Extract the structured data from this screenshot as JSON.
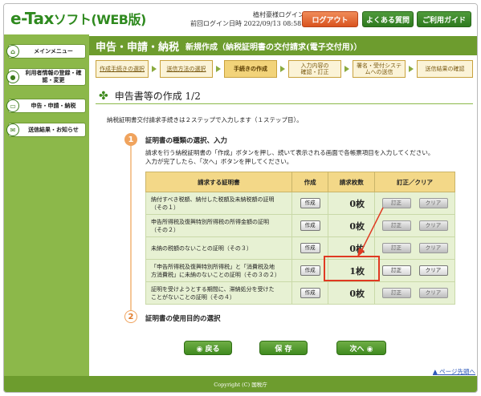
{
  "header": {
    "logo_main": "e-Tax",
    "logo_sub": "ソフト(WEB版)",
    "login_user": "植村豪様ログイン中",
    "last_login_label": "前回ログイン日時",
    "last_login_value": "2022/09/13 08:58",
    "logout_label": "ログアウト",
    "faq_label": "よくある質問",
    "guide_label": "ご利用ガイド"
  },
  "sidebar": {
    "items": [
      {
        "label": "メインメニュー",
        "icon": "house-icon"
      },
      {
        "label": "利用者情報の登録・確認・変更",
        "icon": "person-icon"
      },
      {
        "label": "申告・申請・納税",
        "icon": "document-icon"
      },
      {
        "label": "送信結果・お知らせ",
        "icon": "mail-icon"
      }
    ]
  },
  "main": {
    "title": "申告・申請・納税",
    "subtitle": "新規作成（納税証明書の交付請求(電子交付用)）",
    "steps": [
      "作成手続きの選択",
      "送信方法の選択",
      "手続きの作成",
      "入力内容の\n確認・訂正",
      "署名・受付システ\nムへの送信",
      "送信結果の確認"
    ],
    "section_title": "申告書等の作成 1/2",
    "intro": "納税証明書交付請求手続きは２ステップで入力します（１ステップ目）。",
    "step1_num": "1",
    "step1_title": "証明書の種類の選択、入力",
    "step1_desc_line1": "請求を行う納税証明書の「作成」ボタンを押し、続いて表示される画面で各帳票項目を入力してください。",
    "step1_desc_line2": "入力が完了したら、「次へ」ボタンを押してください。",
    "step2_num": "2",
    "step2_title": "証明書の使用目的の選択"
  },
  "table": {
    "headers": [
      "請求する証明書",
      "作成",
      "請求枚数",
      "訂正／クリア"
    ],
    "create_label": "作成",
    "edit_label": "訂正",
    "clear_label": "クリア",
    "rows": [
      {
        "name": "納付すべき税額、納付した税額及未納税額の証明\n（その１）",
        "count": "0枚"
      },
      {
        "name": "申告所得税及復興特別所得税の所得金額の証明\n（その２）",
        "count": "0枚"
      },
      {
        "name": "未納の税額のないことの証明（その３）",
        "count": "0枚"
      },
      {
        "name": "「申告所得税及復興特別所得税」と「消費税及地\n方消費税」に未納のないことの証明（その３の２）",
        "count": "1枚"
      },
      {
        "name": "証明を受けようとする期間に、滞納処分を受けた\nことがないことの証明（その４）",
        "count": "0枚"
      }
    ]
  },
  "footer_buttons": {
    "back": "◉ 戻る",
    "save": "保 存",
    "next": "次へ ◉"
  },
  "page_top": "ページ先頭へ",
  "footer": "Copyright (C) 国税庁",
  "colors": {
    "brand_green": "#6d9c2e",
    "logout_orange": "#e0642a",
    "highlight_red": "#e03a22"
  }
}
